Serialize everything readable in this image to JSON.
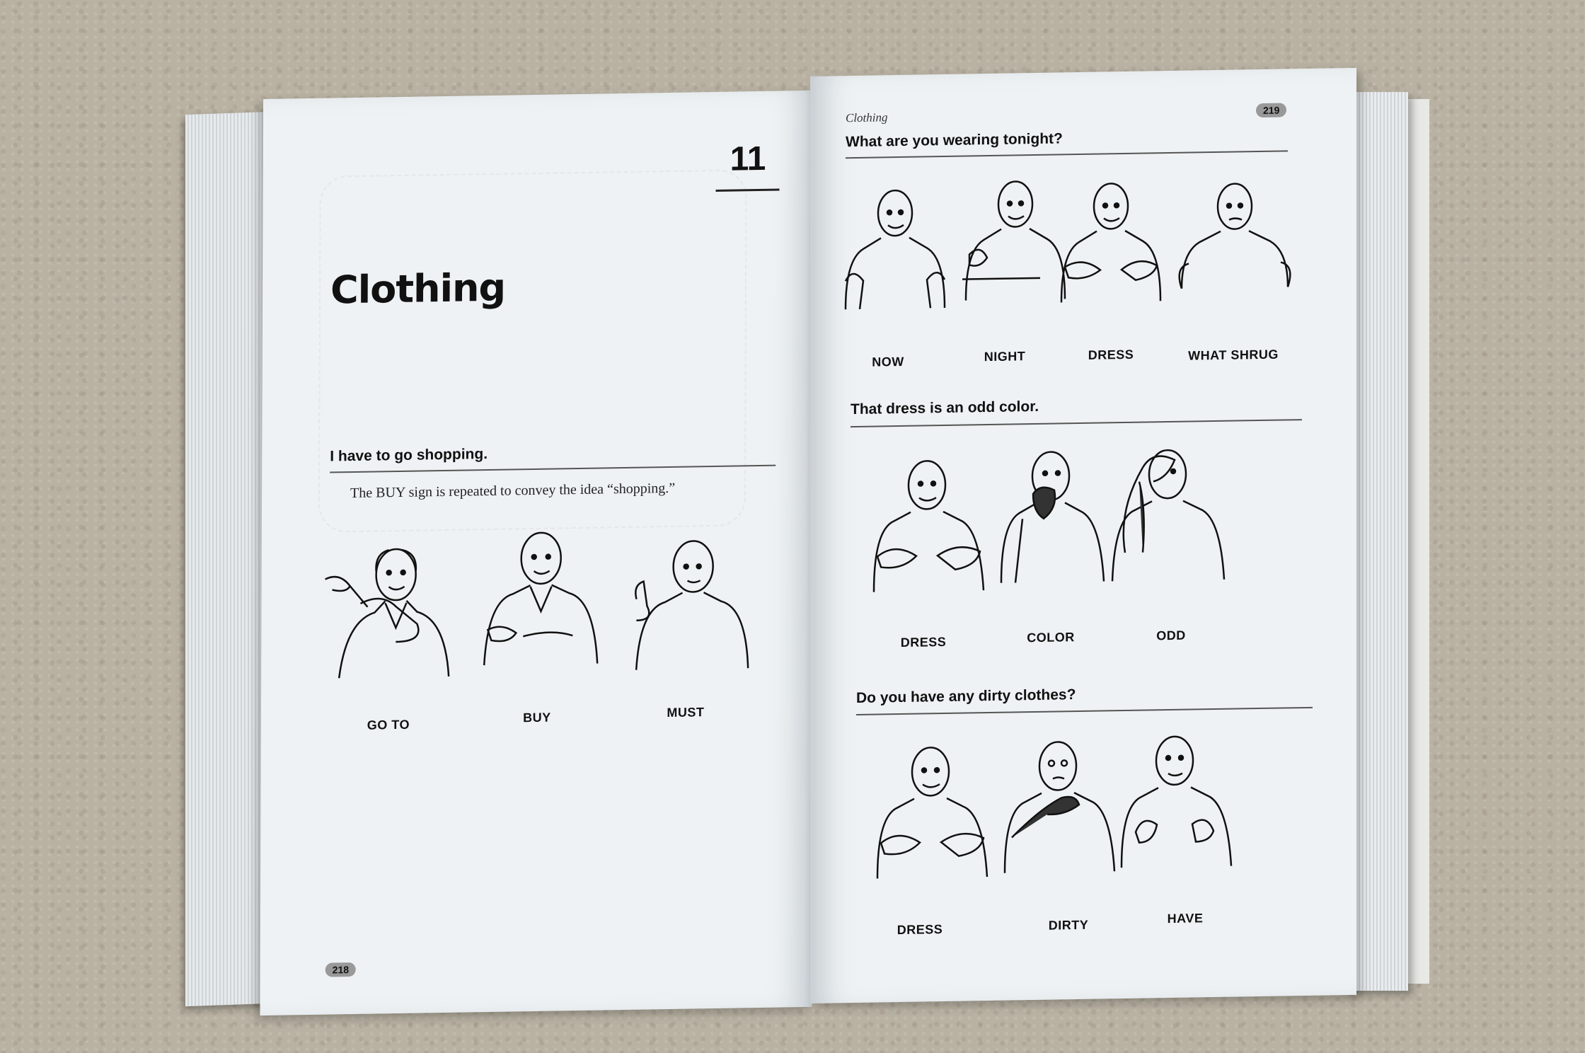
{
  "left_page": {
    "chapter_number": "11",
    "chapter_title": "Clothing",
    "section": {
      "heading": "I have to go shopping.",
      "note": "The BUY sign is repeated to convey the idea “shopping.”",
      "signs": [
        "GO TO",
        "BUY",
        "MUST"
      ]
    },
    "page_number": "218"
  },
  "right_page": {
    "running_header": "Clothing",
    "page_number": "219",
    "sections": [
      {
        "heading": "What are you wearing tonight?",
        "signs": [
          "NOW",
          "NIGHT",
          "DRESS",
          "WHAT SHRUG"
        ]
      },
      {
        "heading": "That dress is an odd color.",
        "signs": [
          "DRESS",
          "COLOR",
          "ODD"
        ]
      },
      {
        "heading": "Do you have any dirty clothes?",
        "signs": [
          "DRESS",
          "DIRTY",
          "HAVE"
        ]
      }
    ]
  },
  "colors": {
    "page": "#eef2f4",
    "ink": "#111111",
    "carpet": "#b9b2a3"
  }
}
